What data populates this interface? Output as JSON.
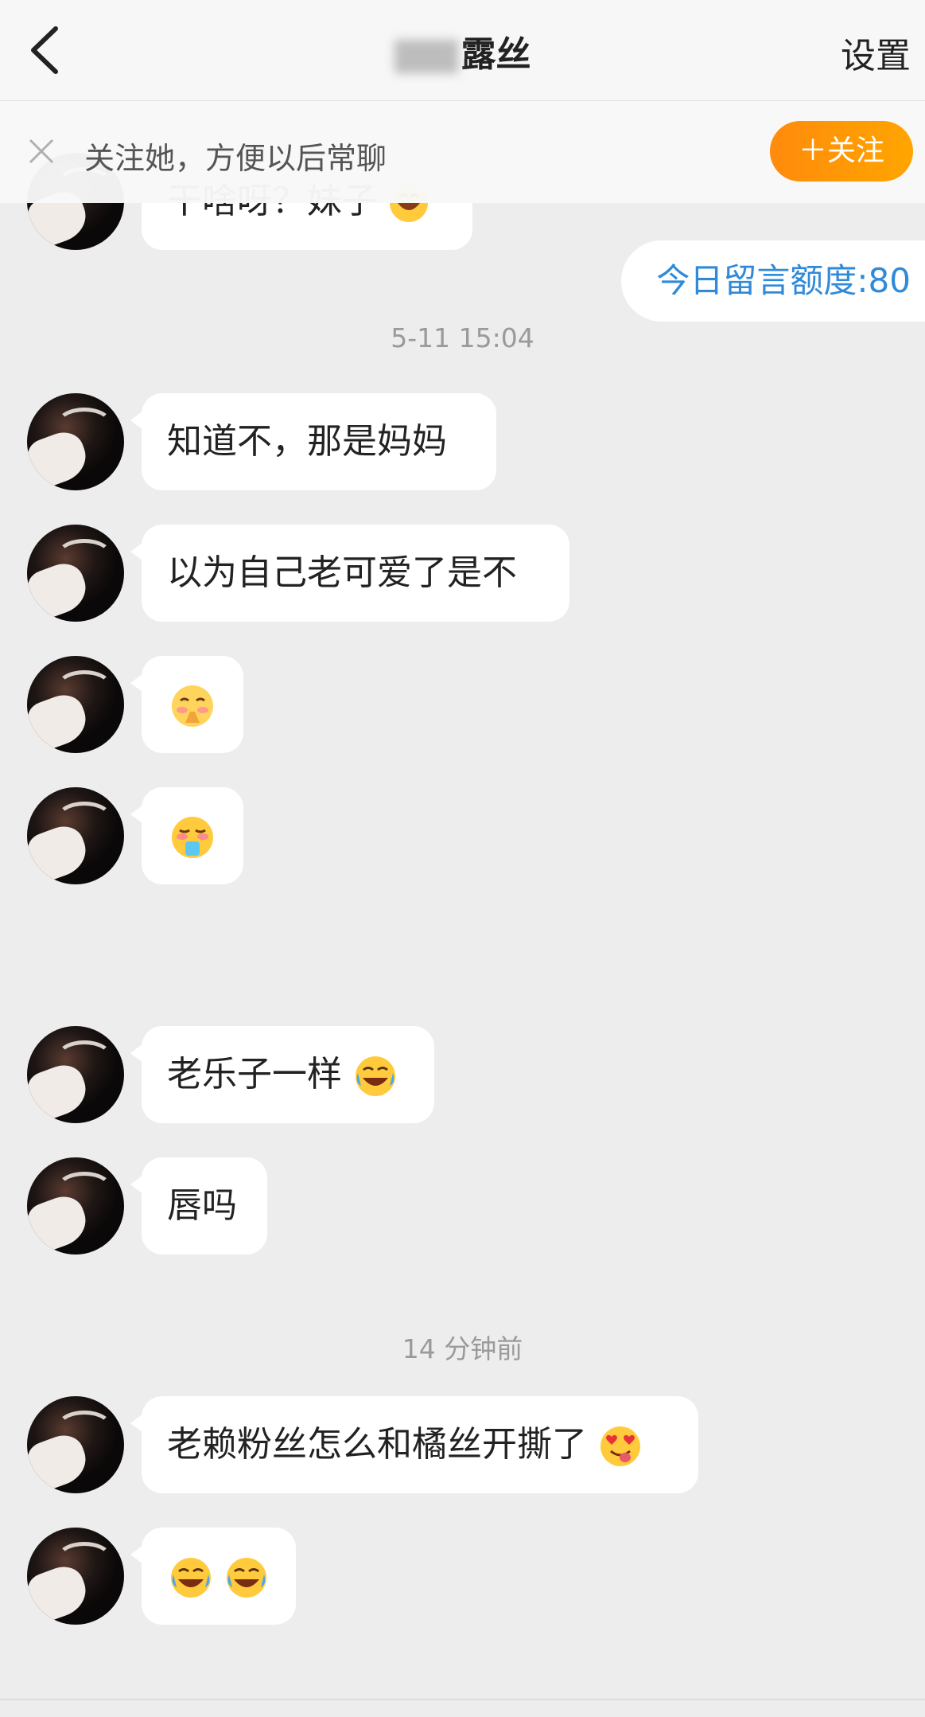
{
  "header": {
    "title_suffix": "露丝",
    "settings_label": "设置"
  },
  "follow_bar": {
    "text": "关注她，方便以后常聊",
    "button_label": "＋关注"
  },
  "quota": "今日留言额度:80",
  "timestamps": [
    "5-11 15:04",
    "14 分钟前"
  ],
  "messages": [
    {
      "text": "干啥呀？妹子"
    },
    {
      "text": "知道不，那是妈妈"
    },
    {
      "text": "以为自己老可爱了是不"
    },
    {
      "text": "",
      "emoji": "shy-face-icon"
    },
    {
      "text": "",
      "emoji": "drooling-face-icon"
    },
    {
      "text": "老乐子一样"
    },
    {
      "text": "唇吗"
    },
    {
      "text": "老赖粉丝怎么和橘丝开撕了"
    },
    {
      "text": "",
      "emoji": "two-crying-laughing-icon"
    }
  ],
  "colors": {
    "accent": "#ff9a0a",
    "link": "#2f8ad9",
    "background": "#ededed"
  }
}
